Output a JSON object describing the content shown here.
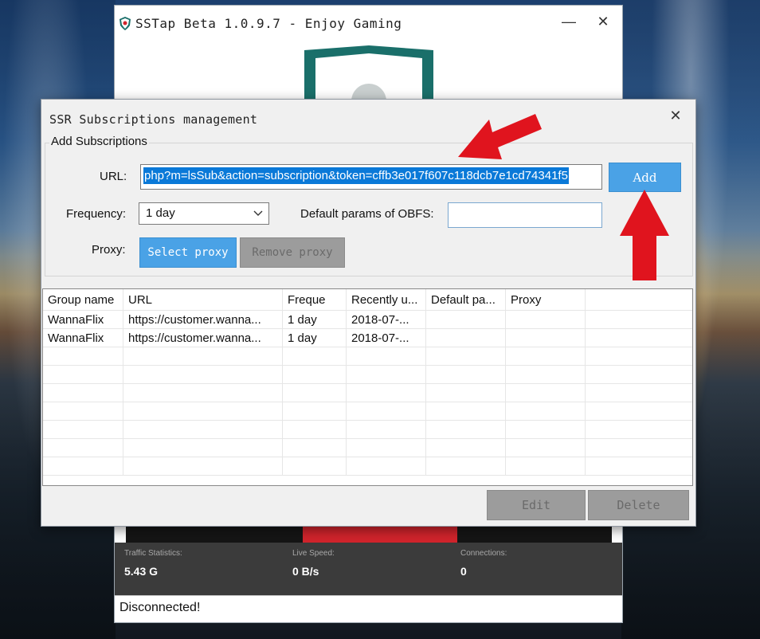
{
  "colors": {
    "accent_blue": "#4aa2e6",
    "selection_blue": "#0a79d8",
    "arrow_red": "#e0141e",
    "disabled_gray": "#9c9c9c",
    "stats_bg": "#3b3b3b"
  },
  "main_window": {
    "title": "SSTap Beta 1.0.9.7 - Enjoy Gaming",
    "minimize_symbol": "—",
    "close_symbol": "✕",
    "stats": {
      "traffic_label": "Traffic Statistics:",
      "traffic_value": "5.43 G",
      "speed_label": "Live Speed:",
      "speed_value": "0 B/s",
      "connections_label": "Connections:",
      "connections_value": "0"
    },
    "status": "Disconnected!"
  },
  "dialog": {
    "title": "SSR Subscriptions management",
    "close_symbol": "✕",
    "group_title": "Add Subscriptions",
    "url_label": "URL:",
    "url_value": "php?m=lsSub&action=subscription&token=cffb3e017f607c118dcb7e1cd74341f5",
    "add_label": "Add",
    "frequency_label": "Frequency:",
    "frequency_value": "1 day",
    "obfs_label": "Default params of OBFS:",
    "obfs_value": "",
    "proxy_label": "Proxy:",
    "select_proxy_label": "Select proxy",
    "remove_proxy_label": "Remove proxy",
    "table": {
      "headers": [
        "Group name",
        "URL",
        "Freque",
        "Recently u...",
        "Default pa...",
        "Proxy"
      ],
      "rows": [
        [
          "WannaFlix",
          "https://customer.wanna...",
          "1 day",
          "2018-07-...",
          "",
          ""
        ],
        [
          "WannaFlix",
          "https://customer.wanna...",
          "1 day",
          "2018-07-...",
          "",
          ""
        ]
      ]
    },
    "edit_label": "Edit",
    "delete_label": "Delete"
  }
}
